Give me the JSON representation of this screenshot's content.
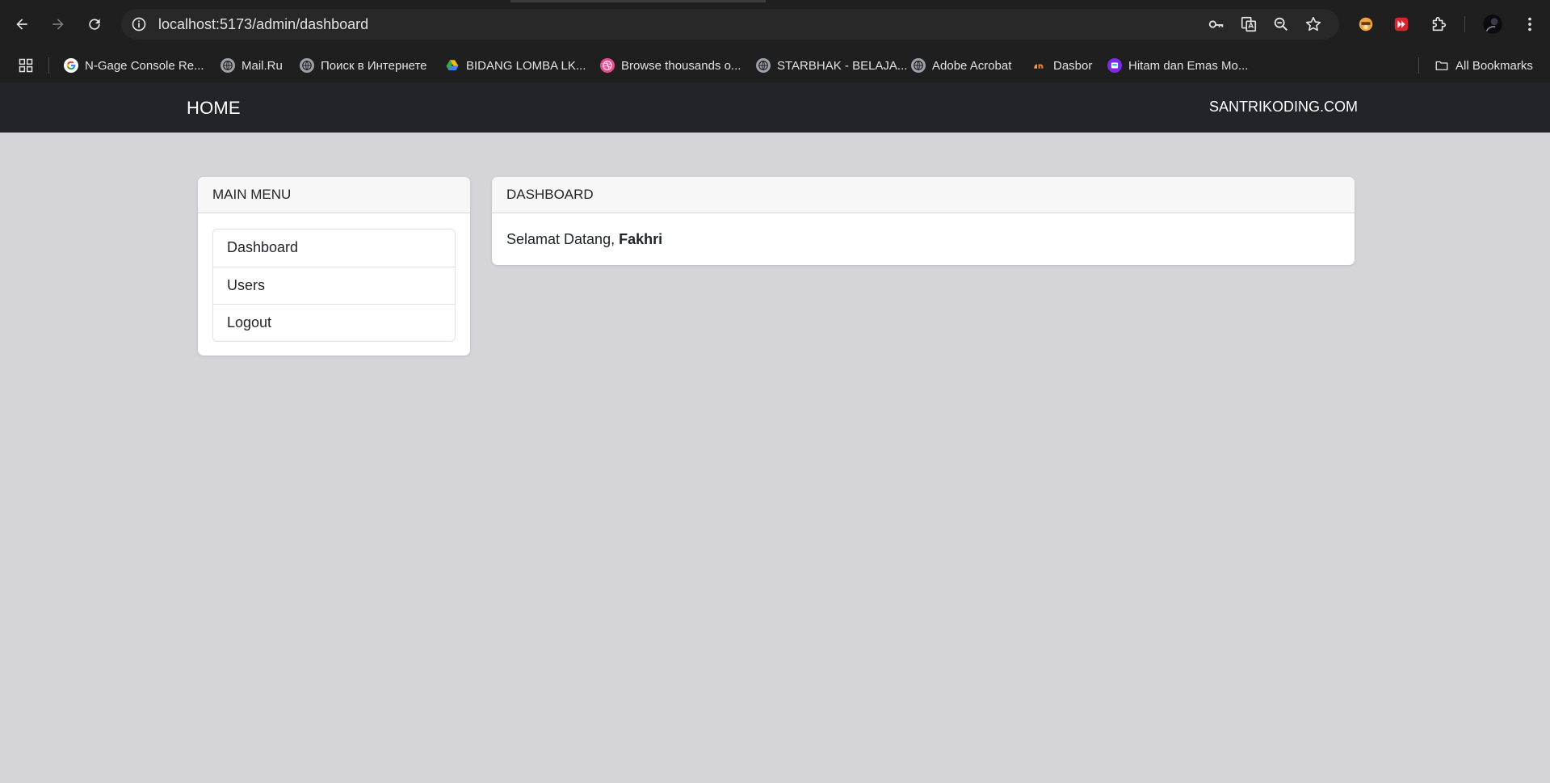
{
  "browser": {
    "url": "localhost:5173/admin/dashboard",
    "bookmarks": [
      {
        "label": "N-Gage Console Re...",
        "icon": "google-icon"
      },
      {
        "label": "Mail.Ru",
        "icon": "globe-icon"
      },
      {
        "label": "Поиск в Интернете",
        "icon": "globe-icon"
      },
      {
        "label": "BIDANG LOMBA LK...",
        "icon": "google-drive-icon"
      },
      {
        "label": "Browse thousands o...",
        "icon": "dribbble-icon"
      },
      {
        "label": "STARBHAK - BELAJA...",
        "icon": "globe-icon"
      },
      {
        "label": "Adobe Acrobat",
        "icon": "globe-icon"
      },
      {
        "label": "Dasbor",
        "icon": "dasbor-icon"
      },
      {
        "label": "Hitam dan Emas Mo...",
        "icon": "canva-icon"
      }
    ],
    "all_bookmarks_label": "All Bookmarks"
  },
  "navbar": {
    "home": "HOME",
    "site": "SANTRIKODING.COM"
  },
  "menu": {
    "title": "MAIN MENU",
    "items": [
      "Dashboard",
      "Users",
      "Logout"
    ]
  },
  "dashboard": {
    "title": "DASHBOARD",
    "greeting": "Selamat Datang, ",
    "user": "Fakhri"
  },
  "colors": {
    "page_bg": "#d5d4d8",
    "navbar_bg": "#212529",
    "chrome_bg": "#1f1f1f"
  }
}
